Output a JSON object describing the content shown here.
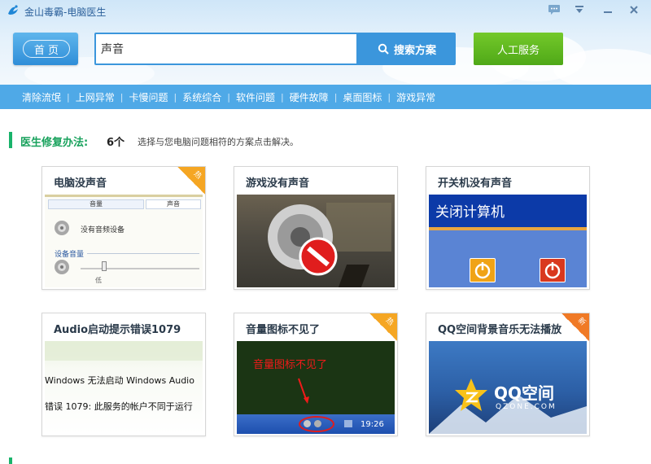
{
  "window": {
    "title": "金山毒霸-电脑医生"
  },
  "header": {
    "home_label": "首 页",
    "search_value": "声音",
    "search_button": "搜索方案",
    "human_service": "人工服务"
  },
  "nav": {
    "items": [
      "清除流氓",
      "上网异常",
      "卡慢问题",
      "系统综合",
      "软件问题",
      "硬件故障",
      "桌面图标",
      "游戏异常"
    ]
  },
  "solutions": {
    "label": "医生修复办法:",
    "count": "6个",
    "hint": "选择与您电脑问题相符的方案点击解决。"
  },
  "cards": [
    {
      "title": "电脑没声音",
      "badge": "热",
      "thumb": {
        "tab1": "音量",
        "tab2": "声音",
        "text1": "没有音频设备",
        "text2": "设备音量",
        "text3": "低"
      }
    },
    {
      "title": "游戏没有声音",
      "badge": ""
    },
    {
      "title": "开关机没有声音",
      "badge": "",
      "thumb": {
        "text": "关闭计算机"
      }
    },
    {
      "title": "Audio启动提示错误1079",
      "badge": "",
      "thumb": {
        "line1": "Windows 无法启动 Windows Audio",
        "line2": "错误 1079: 此服务的帐户不同于运行"
      }
    },
    {
      "title": "音量图标不见了",
      "badge": "热",
      "thumb": {
        "label": "音量图标不见了",
        "time": "19:26"
      }
    },
    {
      "title": "QQ空间背景音乐无法播放",
      "badge": "新",
      "thumb": {
        "brand": "QQ空间",
        "domain": "QZONE.COM"
      }
    }
  ],
  "colors": {
    "accent_blue": "#3b96dc",
    "nav_blue": "#4fa9e7",
    "green": "#4fa818",
    "section_green": "#19a25d"
  }
}
